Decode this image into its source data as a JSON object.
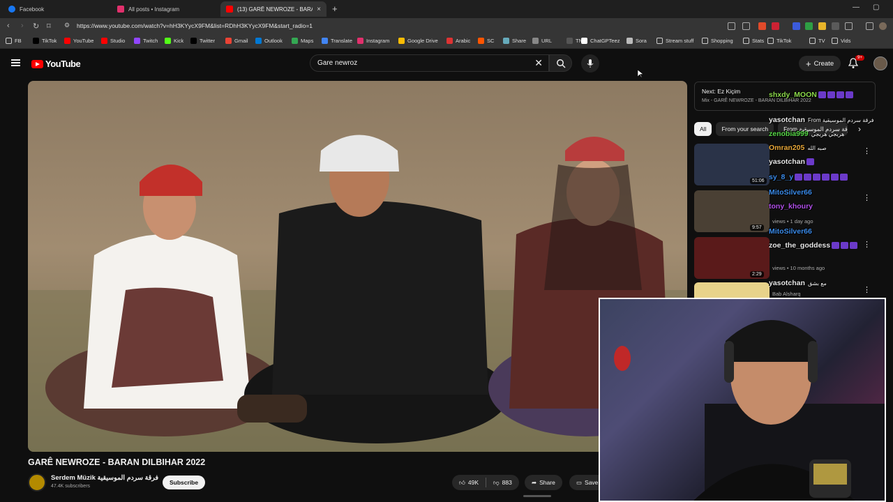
{
  "browser": {
    "tabs": [
      {
        "title": "Facebook",
        "color": "#1877f2"
      },
      {
        "title": "All posts • Instagram",
        "color": "#e1306c"
      },
      {
        "title": "(13) GARÊ NEWROZE - BARAN",
        "color": "#ff0000"
      }
    ],
    "url": "https://www.youtube.com/watch?v=hH3KYycX9FM&list=RDhH3KYycX9FM&start_radio=1",
    "bookmarks": [
      {
        "label": "FB",
        "icon": "folder-icon"
      },
      {
        "label": "TikTok",
        "icon": "tiktok-icon"
      },
      {
        "label": "YouTube",
        "icon": "youtube-icon"
      },
      {
        "label": "Studio",
        "icon": "youtube-icon"
      },
      {
        "label": "Twitch",
        "icon": "twitch-icon"
      },
      {
        "label": "Kick",
        "icon": "kick-icon"
      },
      {
        "label": "Twitter",
        "icon": "x-icon"
      },
      {
        "label": "Gmail",
        "icon": "gmail-icon"
      },
      {
        "label": "Outlook",
        "icon": "outlook-icon"
      },
      {
        "label": "Maps",
        "icon": "maps-icon"
      },
      {
        "label": "Translate",
        "icon": "translate-icon"
      },
      {
        "label": "Instagram",
        "icon": "instagram-icon"
      },
      {
        "label": "Google Drive",
        "icon": "drive-icon"
      },
      {
        "label": "Arabic",
        "icon": "arabic-icon"
      },
      {
        "label": "SC",
        "icon": "sc-icon"
      },
      {
        "label": "Share",
        "icon": "share-icon"
      },
      {
        "label": "URL",
        "icon": "url-icon"
      },
      {
        "label": "TN",
        "icon": "tn-icon"
      },
      {
        "label": "ChatGPTeez",
        "icon": "chatgpt-icon"
      },
      {
        "label": "Sora",
        "icon": "sora-icon"
      },
      {
        "label": "Stream stuff",
        "icon": "folder-icon"
      },
      {
        "label": "Shopping",
        "icon": "folder-icon"
      },
      {
        "label": "Stats",
        "icon": "folder-icon"
      },
      {
        "label": "TikTok",
        "icon": "folder-icon"
      },
      {
        "label": "TV",
        "icon": "folder-icon"
      },
      {
        "label": "Vids",
        "icon": "folder-icon"
      }
    ]
  },
  "youtube": {
    "logo_text": "YouTube",
    "search_query": "Gare newroz",
    "create_label": "Create",
    "notif_badge": "9+",
    "video": {
      "title": "GARÊ NEWROZE - BARAN DILBIHAR 2022",
      "channel": "Serdem Müzik فرقة سردم الموسيقية",
      "subscribers": "47.4K subscribers",
      "subscribe_label": "Subscribe",
      "likes": "49K",
      "dislikes": "883",
      "share_label": "Share",
      "save_label": "Save"
    },
    "up_next": {
      "title": "Next: Ez Kiçim",
      "subtitle": "Mix - GARÊ NEWROZE - BARAN DILBIHAR 2022"
    },
    "chips": [
      "All",
      "From your search",
      "From فرقة سردم الموسيقية"
    ],
    "recommendations": [
      {
        "duration": "51:06",
        "meta": "",
        "thumb_color": "#2a3348"
      },
      {
        "duration": "9:57",
        "meta": "views • 1 day ago",
        "thumb_color": "#4a4034"
      },
      {
        "duration": "2:29",
        "meta": "views • 10 months ago",
        "thumb_color": "#5a1a1a"
      },
      {
        "duration": "",
        "meta": "Bab Alsharq",
        "thumb_color": "#e8d38a"
      }
    ]
  },
  "chat": [
    {
      "user": "shxdy_MOON",
      "color": "#8bd84a",
      "msg": "",
      "emotes": 4
    },
    {
      "user": "yasotchan",
      "color": "#e6e6e6",
      "msg": "From فرقة سردم الموسيقية",
      "emotes": 0
    },
    {
      "user": "zenobia999",
      "color": "#58d848",
      "msg": "هربجي هربجي",
      "emotes": 0
    },
    {
      "user": "Omran205",
      "color": "#e8a83a",
      "msg": "صبه الله",
      "emotes": 0
    },
    {
      "user": "yasotchan",
      "color": "#e6e6e6",
      "msg": "",
      "emotes": 1
    },
    {
      "user": "sy_8_y",
      "color": "#3a8ae8",
      "msg": "",
      "emotes": 6
    },
    {
      "user": "MitoSilver66",
      "color": "#3a8ae8",
      "msg": "",
      "emotes": 0
    },
    {
      "user": "tony_khoury",
      "color": "#b050e8",
      "msg": "",
      "emotes": 0
    },
    {
      "user": "MitoSilver66",
      "color": "#3a8ae8",
      "msg": "",
      "emotes": 0
    },
    {
      "user": "zoe_the_goddess",
      "color": "#e6e6e6",
      "msg": "",
      "emotes": 3
    },
    {
      "user": "yasotchan",
      "color": "#e6e6e6",
      "msg": "مع بشق",
      "emotes": 0
    }
  ]
}
